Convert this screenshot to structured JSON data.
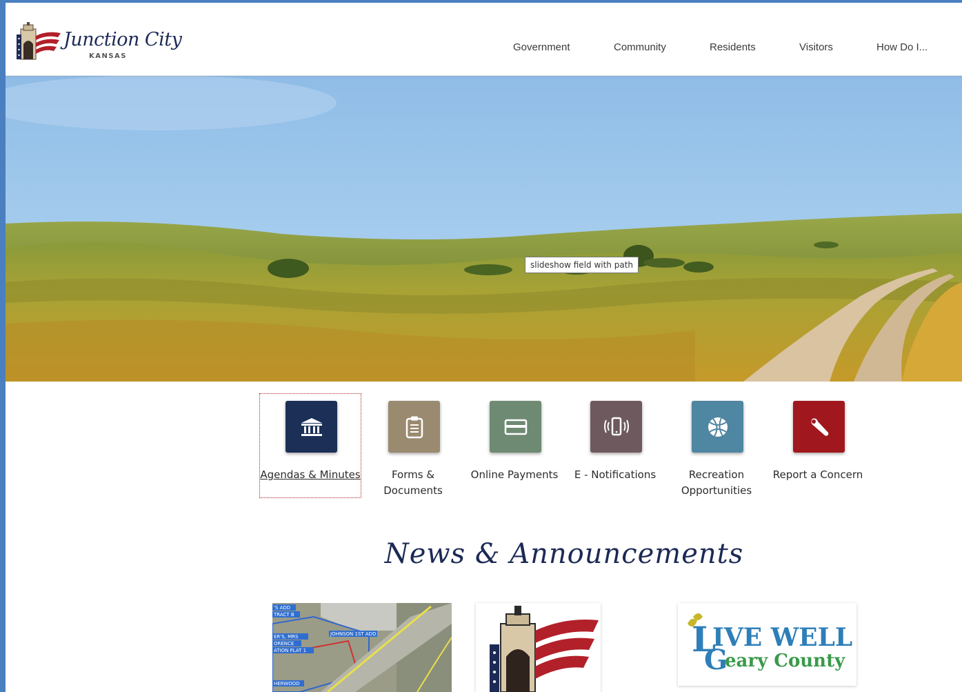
{
  "logo": {
    "script": "Junction City",
    "state": "KANSAS"
  },
  "nav": {
    "items": [
      {
        "label": "Government"
      },
      {
        "label": "Community"
      },
      {
        "label": "Residents"
      },
      {
        "label": "Visitors"
      },
      {
        "label": "How Do I..."
      }
    ]
  },
  "hero": {
    "tooltip": "slideshow field with path"
  },
  "quick_links": [
    {
      "label": "Agendas & Minutes",
      "icon": "government-building-icon",
      "color": "#1c2f57"
    },
    {
      "label": "Forms & Documents",
      "icon": "clipboard-icon",
      "color": "#9a8a70"
    },
    {
      "label": "Online Payments",
      "icon": "credit-card-icon",
      "color": "#6f8a72"
    },
    {
      "label": "E - Notifications",
      "icon": "mobile-alert-icon",
      "color": "#6e5a5e"
    },
    {
      "label": "Recreation Opportunities",
      "icon": "basketball-icon",
      "color": "#4f86a1"
    },
    {
      "label": "Report a Concern",
      "icon": "wrench-icon",
      "color": "#a0181e"
    }
  ],
  "news": {
    "title": "News & Announcements",
    "cards": [
      {
        "image": "map-image",
        "map_labels": [
          "'S ADD",
          "TRACT B",
          "ER'S, MRS",
          "ORENCE",
          "ATION PLAT 1",
          "JOHNSON 1ST ADD",
          "HERWOOD"
        ]
      },
      {
        "image": "junction-city-logo-image"
      },
      {
        "image": "live-well-geary-county-logo",
        "logo_text_1": "IVE WELL",
        "logo_text_2": "eary County"
      }
    ]
  }
}
